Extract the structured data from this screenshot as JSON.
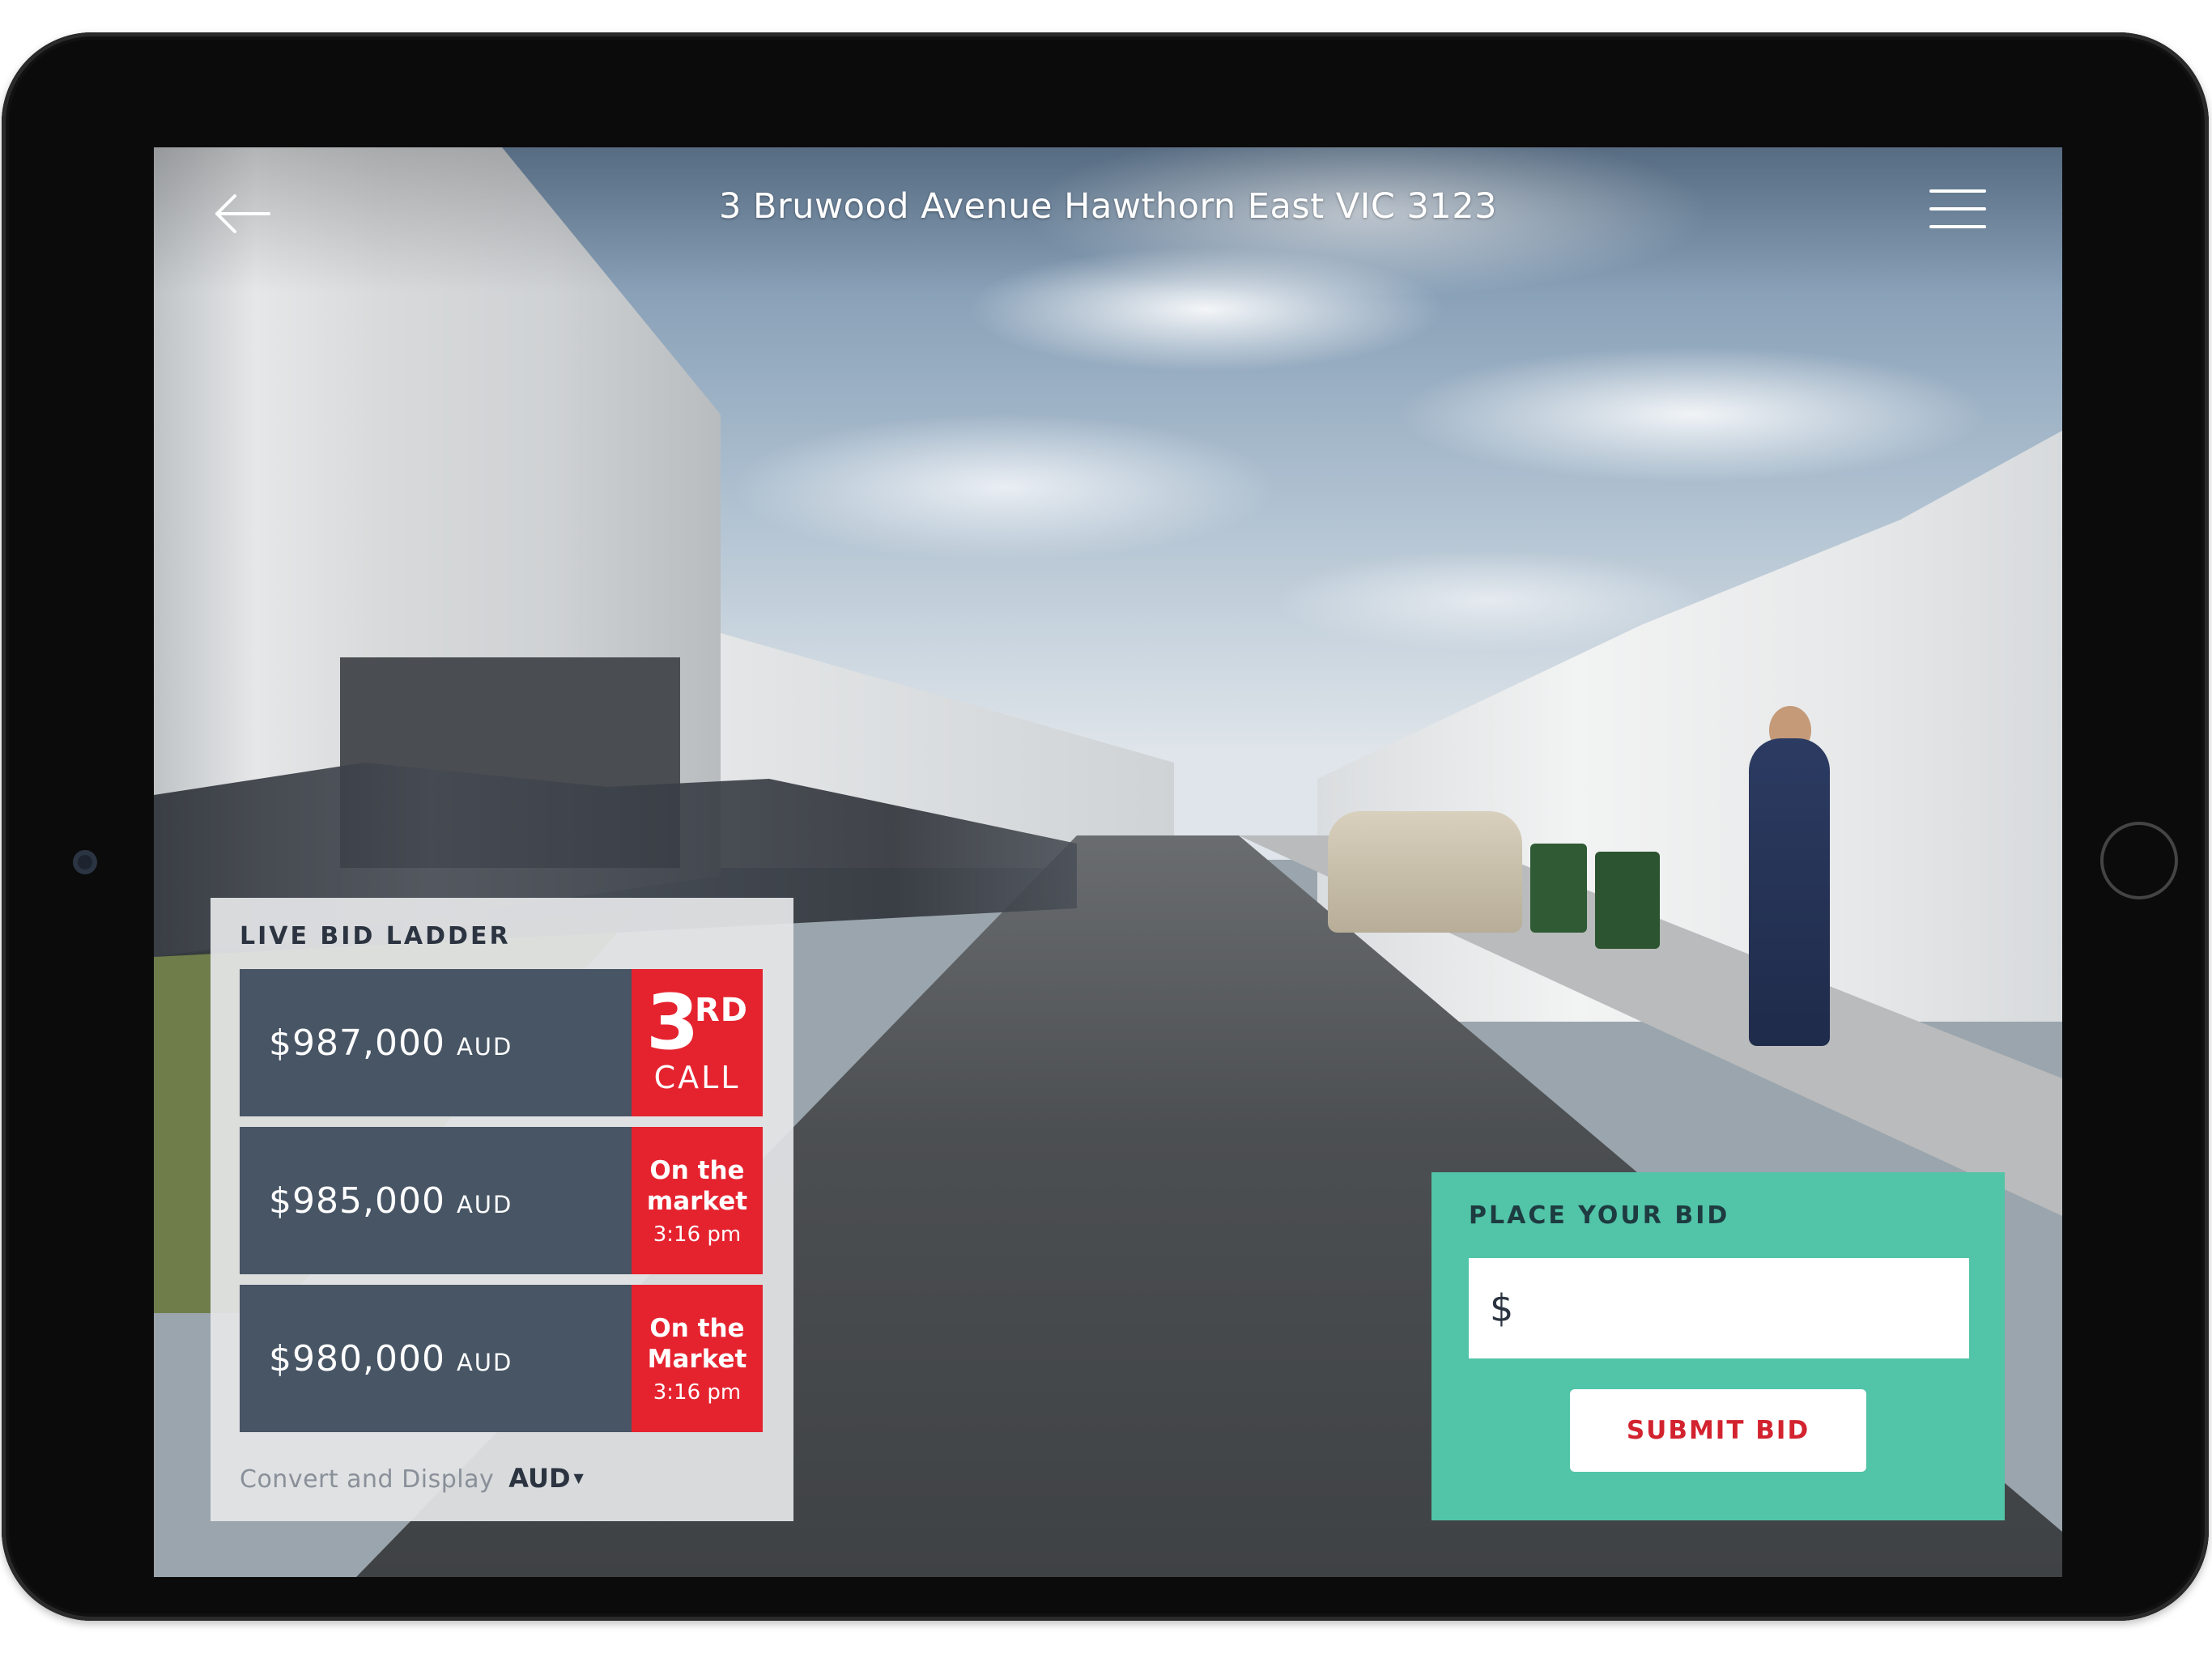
{
  "header": {
    "title": "3 Bruwood Avenue Hawthorn East VIC 3123",
    "back_icon": "arrow-left-icon",
    "menu_icon": "hamburger-menu-icon"
  },
  "bid_ladder": {
    "title": "LIVE BID LADDER",
    "bids": [
      {
        "amount": "$987,000",
        "currency": "AUD",
        "status_type": "call",
        "call_number": "3",
        "call_suffix": "RD",
        "call_word": "CALL"
      },
      {
        "amount": "$985,000",
        "currency": "AUD",
        "status_type": "market",
        "line1": "On the",
        "line2": "market",
        "time": "3:16 pm"
      },
      {
        "amount": "$980,000",
        "currency": "AUD",
        "status_type": "market",
        "line1": "On the",
        "line2": "Market",
        "time": "3:16 pm"
      }
    ],
    "convert_label": "Convert and Display",
    "convert_currency": "AUD"
  },
  "place_bid": {
    "title": "PLACE YOUR BID",
    "currency_symbol": "$",
    "input_value": "",
    "submit_label": "SUBMIT BID"
  },
  "colors": {
    "ladder_row": "#475565",
    "status_red": "#e5232f",
    "bid_panel_teal": "#52c4a8",
    "submit_text": "#d2232f"
  }
}
